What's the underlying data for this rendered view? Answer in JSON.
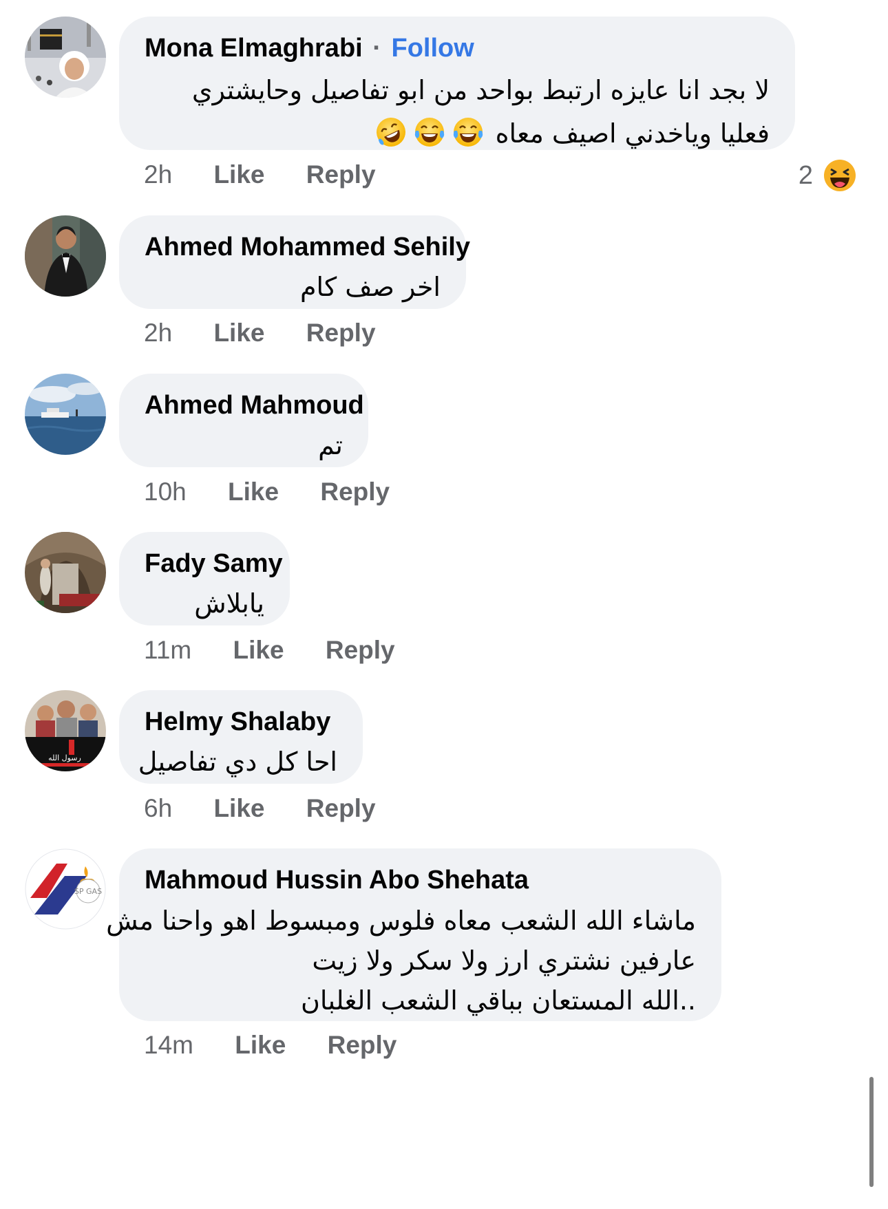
{
  "comments": [
    {
      "author": "Mona Elmaghrabi",
      "separator": "·",
      "follow_label": "Follow",
      "text_lines": [
        "لا بجد انا عايزه ارتبط بواحد من ابو تفاصيل وحايشتري",
        "فعليا وياخدني اصيف معاه"
      ],
      "text_emojis": [
        "tears-of-joy",
        "tears-of-joy",
        "rolling-on-floor-laughing"
      ],
      "time": "2h",
      "like_label": "Like",
      "reply_label": "Reply",
      "reaction_count": "2",
      "reaction_icon": "haha-reaction"
    },
    {
      "author": "Ahmed Mohammed Sehily",
      "text_lines": [
        "اخر صف كام"
      ],
      "time": "2h",
      "like_label": "Like",
      "reply_label": "Reply"
    },
    {
      "author": "Ahmed Mahmoud",
      "text_lines": [
        "تم"
      ],
      "time": "10h",
      "like_label": "Like",
      "reply_label": "Reply"
    },
    {
      "author": "Fady Samy",
      "text_lines": [
        "يابلاش"
      ],
      "time": "11m",
      "like_label": "Like",
      "reply_label": "Reply"
    },
    {
      "author": "Helmy Shalaby",
      "text_lines": [
        "احا كل دي تفاصيل"
      ],
      "time": "6h",
      "like_label": "Like",
      "reply_label": "Reply",
      "avatar_text": "رسول الله"
    },
    {
      "author": "Mahmoud Hussin Abo Shehata",
      "text_lines": [
        "ماشاء الله الشعب معاه فلوس ومبسوط اهو واحنا مش",
        "عارفين نشتري ارز ولا سكر  ولا زيت",
        "..الله المستعان بباقي الشعب الغلبان"
      ],
      "time": "14m",
      "like_label": "Like",
      "reply_label": "Reply",
      "avatar_text": "SP GAS"
    }
  ],
  "colors": {
    "bubble_bg": "#f0f2f5",
    "meta_text": "#65676b",
    "follow_link": "#3578e5",
    "author_text": "#050505"
  }
}
